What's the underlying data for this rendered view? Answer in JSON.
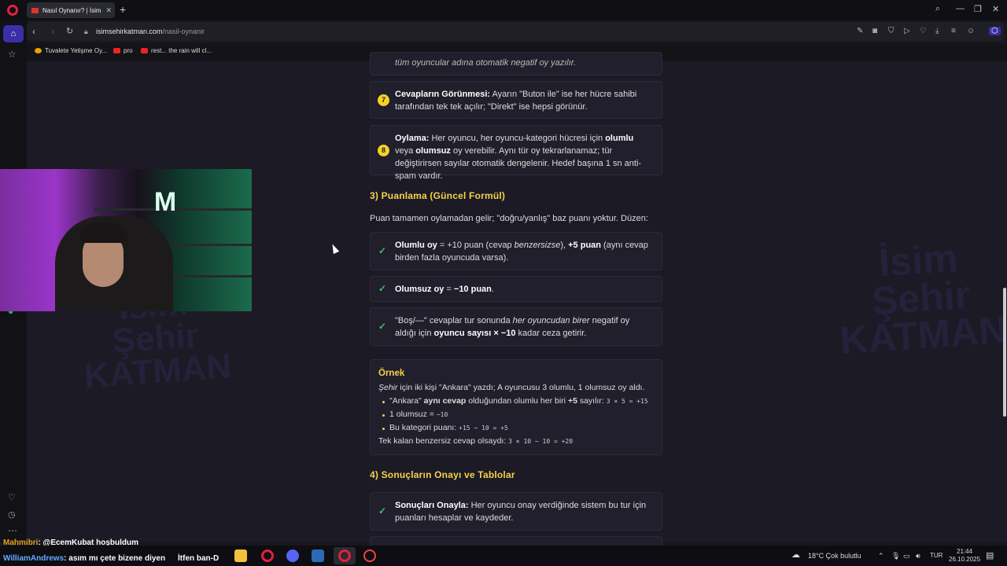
{
  "browser": {
    "tab_title": "Nasıl Oynanır? | İsim Şehir",
    "url_host": "isimsehirkatman.com",
    "url_path": "/nasil-oynanir",
    "bookmarks": [
      "Tuvalete Yetişme Oy...",
      "pro",
      "rest... the rain will cl..."
    ]
  },
  "page": {
    "top_cut_text": "tüm oyuncular adına otomatik negatif oy yazılır.",
    "rule7": {
      "num": "7",
      "lead": "Cevapların Görünmesi:",
      "text": " Ayarın \"Buton ile\" ise her hücre sahibi tarafından tek tek açılır; \"Direkt\" ise hepsi görünür."
    },
    "rule8": {
      "num": "8",
      "lead": "Oylama:",
      "t1": " Her oyuncu, her oyuncu-kategori hücresi için ",
      "b1": "olumlu",
      "t2": " veya ",
      "b2": "olumsuz",
      "t3": " oy verebilir. Aynı tür oy tekrarlanamaz; tür değiştirirsen sayılar otomatik dengelenir. Hedef başına 1 sn anti-spam vardır."
    },
    "section3_title": "3) Puanlama (Güncel Formül)",
    "section3_intro": "Puan tamamen oylamadan gelir; \"doğru/yanlış\" baz puanı yoktur. Düzen:",
    "score1": {
      "b1": "Olumlu oy",
      "t1": " = +10 puan (cevap ",
      "i1": "benzersizse",
      "t2": "), ",
      "b2": "+5 puan",
      "t3": " (aynı cevap birden fazla oyuncuda varsa)."
    },
    "score2": {
      "b1": "Olumsuz oy",
      "t1": " = ",
      "b2": "−10 puan",
      "t2": "."
    },
    "score3": {
      "t1": "\"Boş/—\" cevaplar tur sonunda ",
      "i1": "her oyuncudan birer",
      "t2": " negatif oy aldığı için ",
      "b1": "oyuncu sayısı × −10",
      "t3": " kadar ceza getirir."
    },
    "example": {
      "title": "Örnek",
      "line1_i": "Şehir",
      "line1": " için iki kişi \"Ankara\" yazdı; A oyuncusu 3 olumlu, 1 olumsuz oy aldı.",
      "b1_t1": "\"Ankara\" ",
      "b1_b": "aynı cevap",
      "b1_t2": " olduğundan olumlu her biri ",
      "b1_b2": "+5",
      "b1_t3": " sayılır: ",
      "b1_code": "3 × 5 = +15",
      "b2_t": "1 olumsuz = ",
      "b2_code": "−10",
      "b3_t": "Bu kategori puanı: ",
      "b3_code": "+15 − 10 = +5",
      "last_t": "Tek kalan benzersiz cevap olsaydı: ",
      "last_code": "3 × 10 − 10 = +20"
    },
    "section4_title": "4) Sonuçların Onayı ve Tablolar",
    "confirm": {
      "b1": "Sonuçları Onayla:",
      "t1": " Her oyuncu onay verdiğinde sistem bu tur için puanları hesaplar ve kaydeder."
    },
    "watermark_words": [
      "İsim",
      "Şehir",
      "KATMAN"
    ]
  },
  "overlay": {
    "chat_user": "Mahmibri",
    "chat_text": ": @EcemKubat hoşbuldum",
    "chat2_user": "WilliamAndrews",
    "chat2_text": ": asım mı çete bizene diyen",
    "chat3_text": "İtfen ban-D"
  },
  "taskbar": {
    "weather": "18°C  Çok bulutlu",
    "lang": "TUR",
    "time": "21:44",
    "date": "26.10.2025"
  },
  "colors": {
    "accent": "#f6d24a",
    "check": "#3cc36b",
    "opera": "#e0223a",
    "badge": "#f5d02b"
  }
}
